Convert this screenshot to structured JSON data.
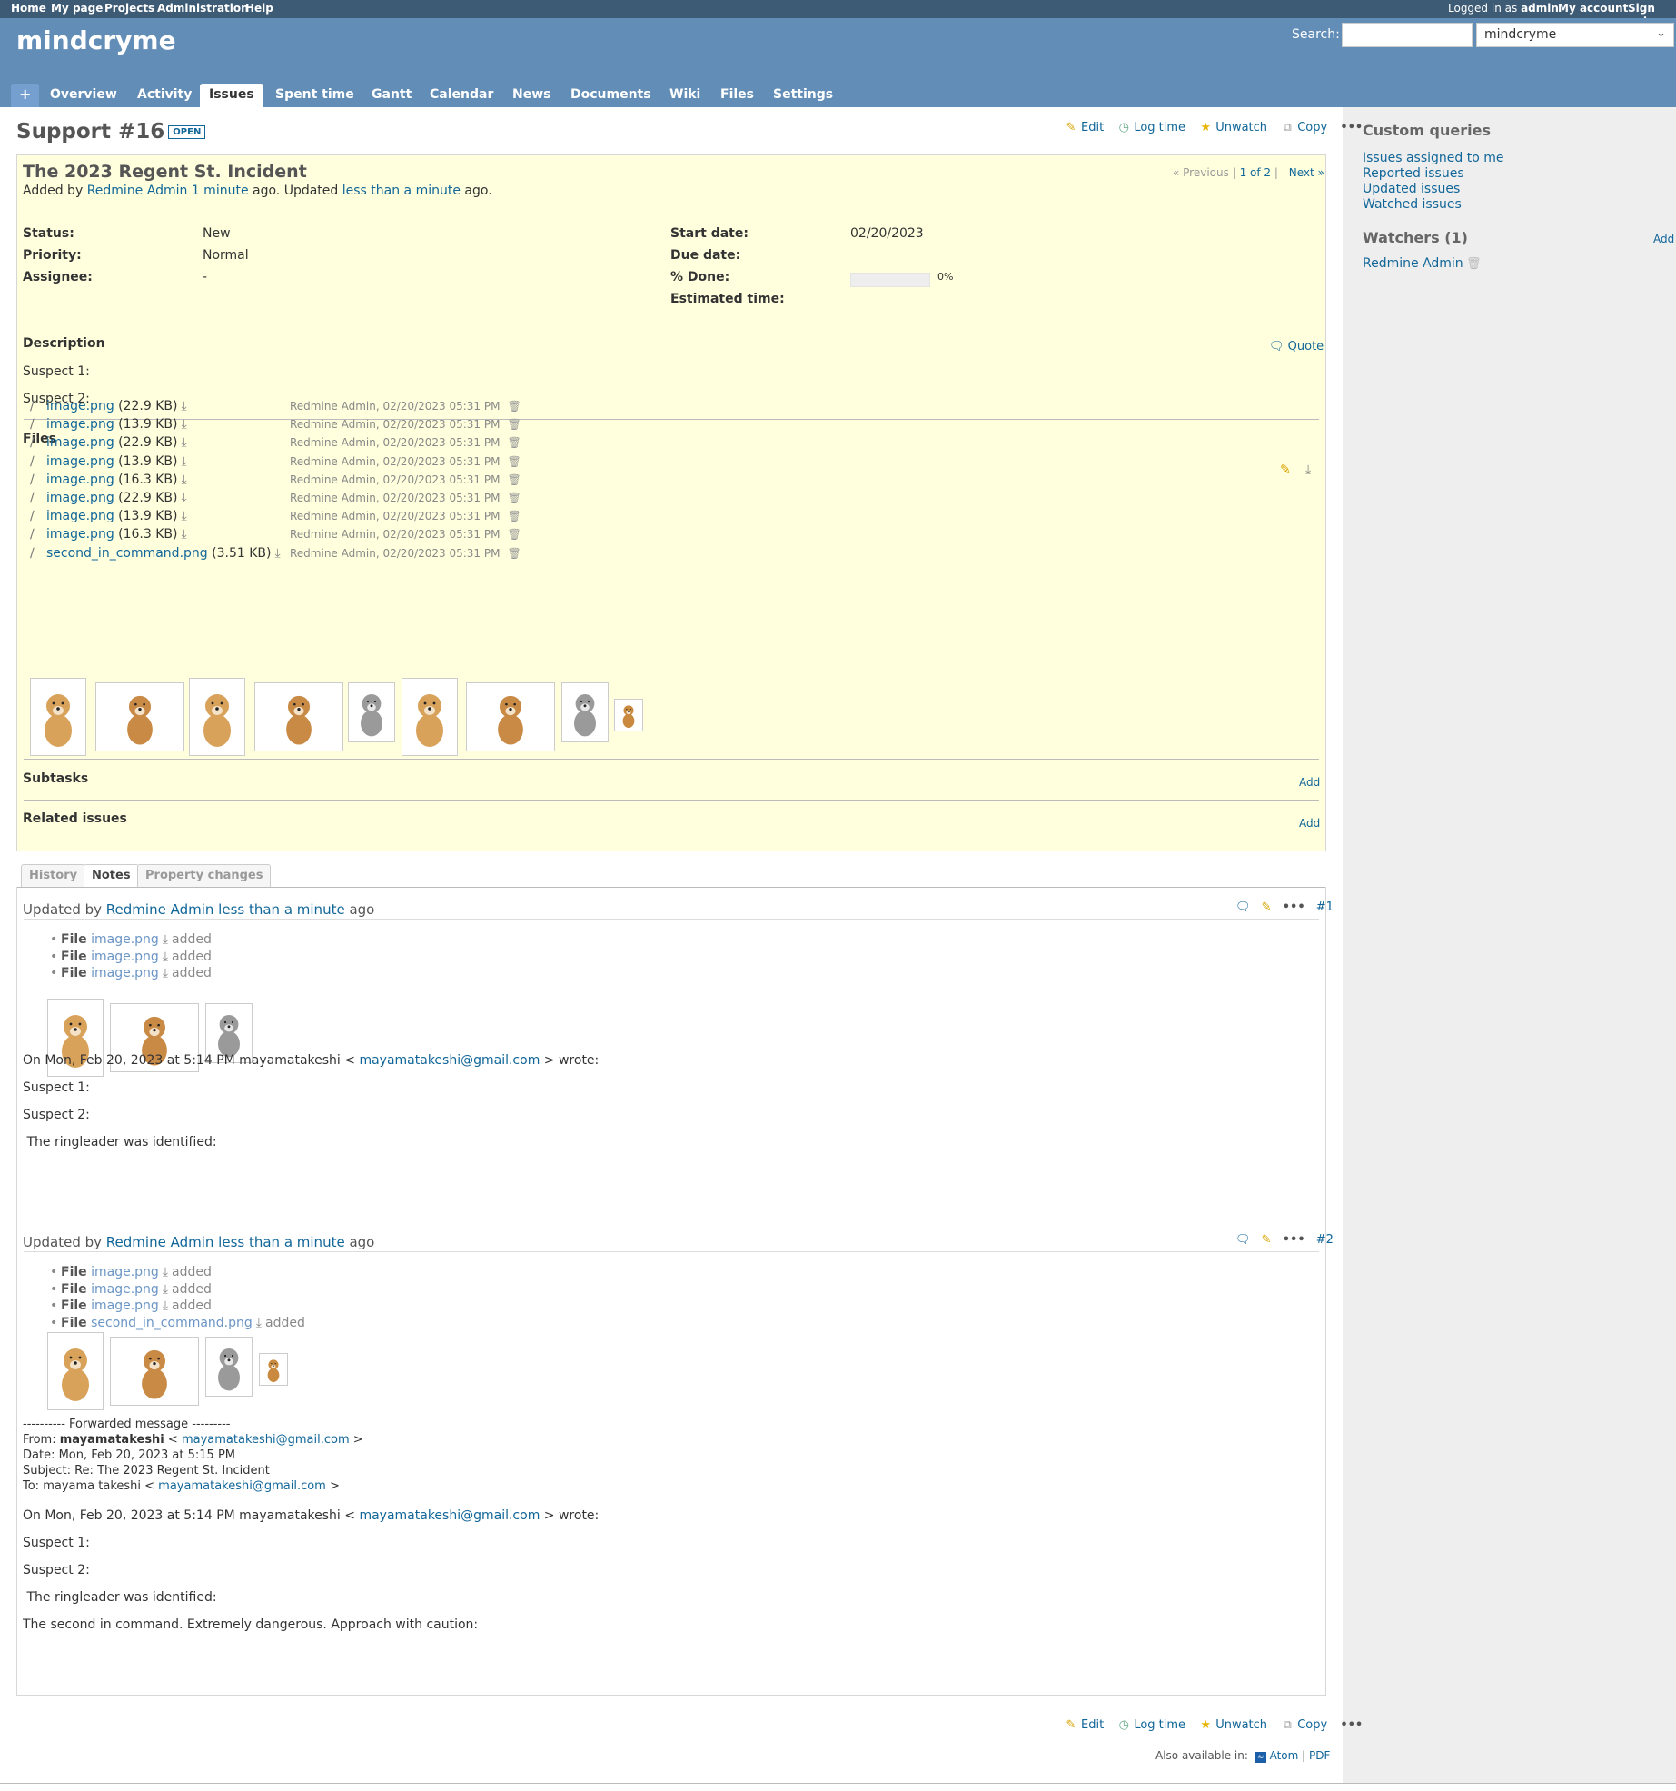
{
  "top_menu": {
    "left": [
      "Home",
      "My page",
      "Projects",
      "Administration",
      "Help"
    ],
    "logged_prefix": "Logged in as",
    "logged_user": "admin",
    "my_account": "My account",
    "sign_out": "Sign out"
  },
  "header": {
    "project_title": "mindcryme",
    "search_label": "Search:",
    "search_value": "",
    "project_select": "mindcryme"
  },
  "main_menu": {
    "new": "+",
    "tabs": [
      "Overview",
      "Activity",
      "Issues",
      "Spent time",
      "Gantt",
      "Calendar",
      "News",
      "Documents",
      "Wiki",
      "Files",
      "Settings"
    ],
    "selected": "Issues"
  },
  "issue": {
    "heading": "Support #16",
    "status_badge": "OPEN",
    "actions": {
      "edit": "Edit",
      "log_time": "Log time",
      "unwatch": "Unwatch",
      "copy": "Copy",
      "more": "•••"
    },
    "pager": {
      "previous": "« Previous",
      "sep1": "|",
      "count": "1 of 2",
      "sep2": "|",
      "next": "Next »"
    },
    "subject": "The 2023 Regent St. Incident",
    "added_by_prefix": "Added by",
    "author": "Redmine Admin",
    "added_ago": "1 minute",
    "ago_updated": "ago. Updated",
    "updated_ago": "less than a minute",
    "ago_end": "ago.",
    "attributes": {
      "status_label": "Status:",
      "status": "New",
      "priority_label": "Priority:",
      "priority": "Normal",
      "assignee_label": "Assignee:",
      "assignee": "-",
      "start_label": "Start date:",
      "start": "02/20/2023",
      "due_label": "Due date:",
      "due": "",
      "done_label": "% Done:",
      "done": "0%",
      "done_value": 0,
      "estimated_label": "Estimated time:",
      "estimated": ""
    },
    "description_label": "Description",
    "quote": "Quote",
    "description_lines": [
      "Suspect 1:",
      "Suspect 2:"
    ],
    "files_label": "Files",
    "files": [
      {
        "name": "image.png",
        "size": "(22.9 KB)",
        "meta": "Redmine Admin, 02/20/2023 05:31 PM"
      },
      {
        "name": "image.png",
        "size": "(13.9 KB)",
        "meta": "Redmine Admin, 02/20/2023 05:31 PM"
      },
      {
        "name": "image.png",
        "size": "(22.9 KB)",
        "meta": "Redmine Admin, 02/20/2023 05:31 PM"
      },
      {
        "name": "image.png",
        "size": "(13.9 KB)",
        "meta": "Redmine Admin, 02/20/2023 05:31 PM"
      },
      {
        "name": "image.png",
        "size": "(16.3 KB)",
        "meta": "Redmine Admin, 02/20/2023 05:31 PM"
      },
      {
        "name": "image.png",
        "size": "(22.9 KB)",
        "meta": "Redmine Admin, 02/20/2023 05:31 PM"
      },
      {
        "name": "image.png",
        "size": "(13.9 KB)",
        "meta": "Redmine Admin, 02/20/2023 05:31 PM"
      },
      {
        "name": "image.png",
        "size": "(16.3 KB)",
        "meta": "Redmine Admin, 02/20/2023 05:31 PM"
      },
      {
        "name": "second_in_command.png",
        "size": "(3.51 KB)",
        "meta": "Redmine Admin, 02/20/2023 05:31 PM"
      }
    ],
    "subtasks_label": "Subtasks",
    "related_label": "Related issues",
    "add": "Add"
  },
  "history_tabs": [
    "History",
    "Notes",
    "Property changes"
  ],
  "history_selected": "Notes",
  "journals": [
    {
      "updated_by": "Updated by",
      "author": "Redmine Admin",
      "when": "less than a minute",
      "ago": "ago",
      "number": "#1",
      "details": [
        {
          "kind": "File",
          "name": "image.png",
          "action": "added"
        },
        {
          "kind": "File",
          "name": "image.png",
          "action": "added"
        },
        {
          "kind": "File",
          "name": "image.png",
          "action": "added"
        }
      ],
      "quote_prefix": "On Mon, Feb 20, 2023 at 5:14 PM mayamatakeshi <",
      "quote_email": "mayamatakeshi@gmail.com",
      "quote_suffix": "> wrote:",
      "lines": [
        "Suspect 1:",
        "Suspect 2:",
        " The ringleader was identified:"
      ]
    },
    {
      "updated_by": "Updated by",
      "author": "Redmine Admin",
      "when": "less than a minute",
      "ago": "ago",
      "number": "#2",
      "details": [
        {
          "kind": "File",
          "name": "image.png",
          "action": "added"
        },
        {
          "kind": "File",
          "name": "image.png",
          "action": "added"
        },
        {
          "kind": "File",
          "name": "image.png",
          "action": "added"
        },
        {
          "kind": "File",
          "name": "second_in_command.png",
          "action": "added"
        }
      ],
      "forward": {
        "header": "---------- Forwarded message ---------",
        "from_label": "From:",
        "from_name": "mayamatakeshi",
        "from_open": "<",
        "from_email": "mayamatakeshi@gmail.com",
        "from_close": ">",
        "date": "Date: Mon, Feb 20, 2023 at 5:15 PM",
        "subject": "Subject: Re: The 2023 Regent St. Incident",
        "to_prefix": "To: mayama takeshi <",
        "to_email": "mayamatakeshi@gmail.com",
        "to_close": ">"
      },
      "quote_prefix": "On Mon, Feb 20, 2023 at 5:14 PM mayamatakeshi <",
      "quote_email": "mayamatakeshi@gmail.com",
      "quote_suffix": "> wrote:",
      "lines": [
        "Suspect 1:",
        "Suspect 2:",
        " The ringleader was identified:",
        "The second in command. Extremely dangerous. Approach with caution:"
      ]
    }
  ],
  "sidebar": {
    "queries_title": "Custom queries",
    "queries": [
      "Issues assigned to me",
      "Reported issues",
      "Updated issues",
      "Watched issues"
    ],
    "watchers_title": "Watchers (1)",
    "watchers_add": "Add",
    "watcher": "Redmine Admin"
  },
  "footer": {
    "also_available": "Also available in:",
    "atom": "Atom",
    "sep": "|",
    "pdf": "PDF"
  },
  "colors": {
    "top_menu_bg": "#3e5b76",
    "header_bg": "#628db6",
    "issue_bg": "#ffffdd",
    "link": "#116699",
    "sidebar_bg": "#eeeeee"
  }
}
